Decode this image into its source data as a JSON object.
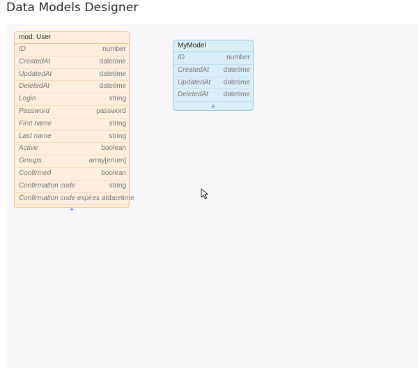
{
  "page": {
    "title": "Data Models Designer"
  },
  "models": [
    {
      "title": "mod: User",
      "add_label": "+",
      "fields": [
        {
          "name": "ID",
          "type": "number"
        },
        {
          "name": "CreatedAt",
          "type": "datetime"
        },
        {
          "name": "UpdatedAt",
          "type": "datetime"
        },
        {
          "name": "DeletedAt",
          "type": "datetime"
        },
        {
          "name": "Login",
          "type": "string"
        },
        {
          "name": "Password",
          "type": "password"
        },
        {
          "name": "First name",
          "type": "string"
        },
        {
          "name": "Last name",
          "type": "string"
        },
        {
          "name": "Active",
          "type": "boolean"
        },
        {
          "name": "Groups",
          "type": "array[enum]"
        },
        {
          "name": "Confirmed",
          "type": "boolean"
        },
        {
          "name": "Confirmation code",
          "type": "string"
        },
        {
          "name": "Confirmation code expires at",
          "type": "datetime"
        }
      ]
    },
    {
      "title": "MyModel",
      "add_label": "+",
      "fields": [
        {
          "name": "ID",
          "type": "number"
        },
        {
          "name": "CreatedAt",
          "type": "datetime"
        },
        {
          "name": "UpdatedAt",
          "type": "datetime"
        },
        {
          "name": "DeletedAt",
          "type": "datetime"
        }
      ]
    }
  ],
  "colors": {
    "user_model_bg": "#fdeedd",
    "user_model_border": "#f4c27f",
    "my_model_bg": "#daeef8",
    "my_model_border": "#8fcdea",
    "add_accent": "#3b78e7",
    "canvas_bg": "#f8f7fa"
  },
  "icons": {
    "cursor": "mouse-pointer-icon"
  }
}
